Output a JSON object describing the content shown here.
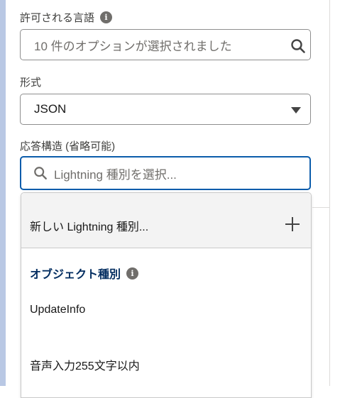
{
  "allowed_languages": {
    "label": "許可される言語",
    "value": "10 件のオプションが選択されました"
  },
  "format": {
    "label": "形式",
    "value": "JSON"
  },
  "response_structure": {
    "label": "応答構造 (省略可能)",
    "placeholder": "Lightning 種別を選択..."
  },
  "dropdown": {
    "new_option": "新しい Lightning 種別...",
    "group_label": "オブジェクト種別",
    "items": [
      "UpdateInfo",
      "音声入力255文字以内"
    ]
  },
  "icons": {
    "info": "info-icon",
    "search": "search-icon",
    "caret": "chevron-down-icon",
    "add": "plus-icon"
  }
}
